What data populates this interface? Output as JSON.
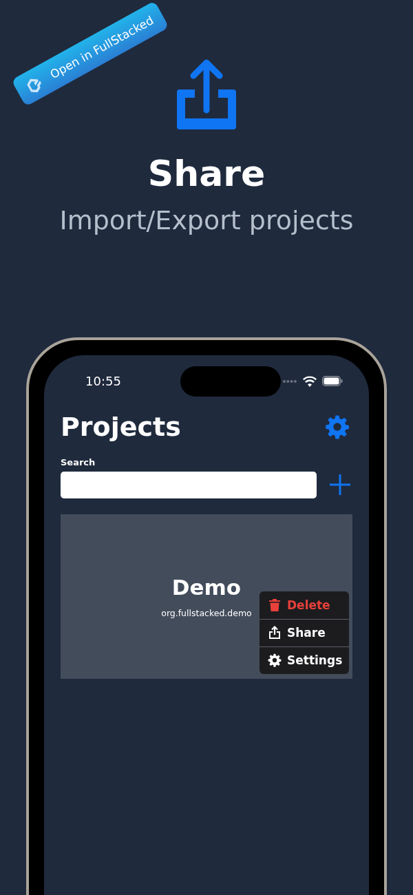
{
  "ribbon": {
    "label": "Open in FullStacked"
  },
  "hero": {
    "title": "Share",
    "subtitle": "Import/Export projects"
  },
  "status_bar": {
    "time": "10:55"
  },
  "header": {
    "title": "Projects"
  },
  "search": {
    "label": "Search"
  },
  "projects": [
    {
      "title": "Demo",
      "id": "org.fullstacked.demo"
    }
  ],
  "context_menu": [
    {
      "kind": "delete",
      "label": "Delete",
      "destructive": true
    },
    {
      "kind": "share",
      "label": "Share",
      "destructive": false
    },
    {
      "kind": "settings",
      "label": "Settings",
      "destructive": false
    }
  ]
}
